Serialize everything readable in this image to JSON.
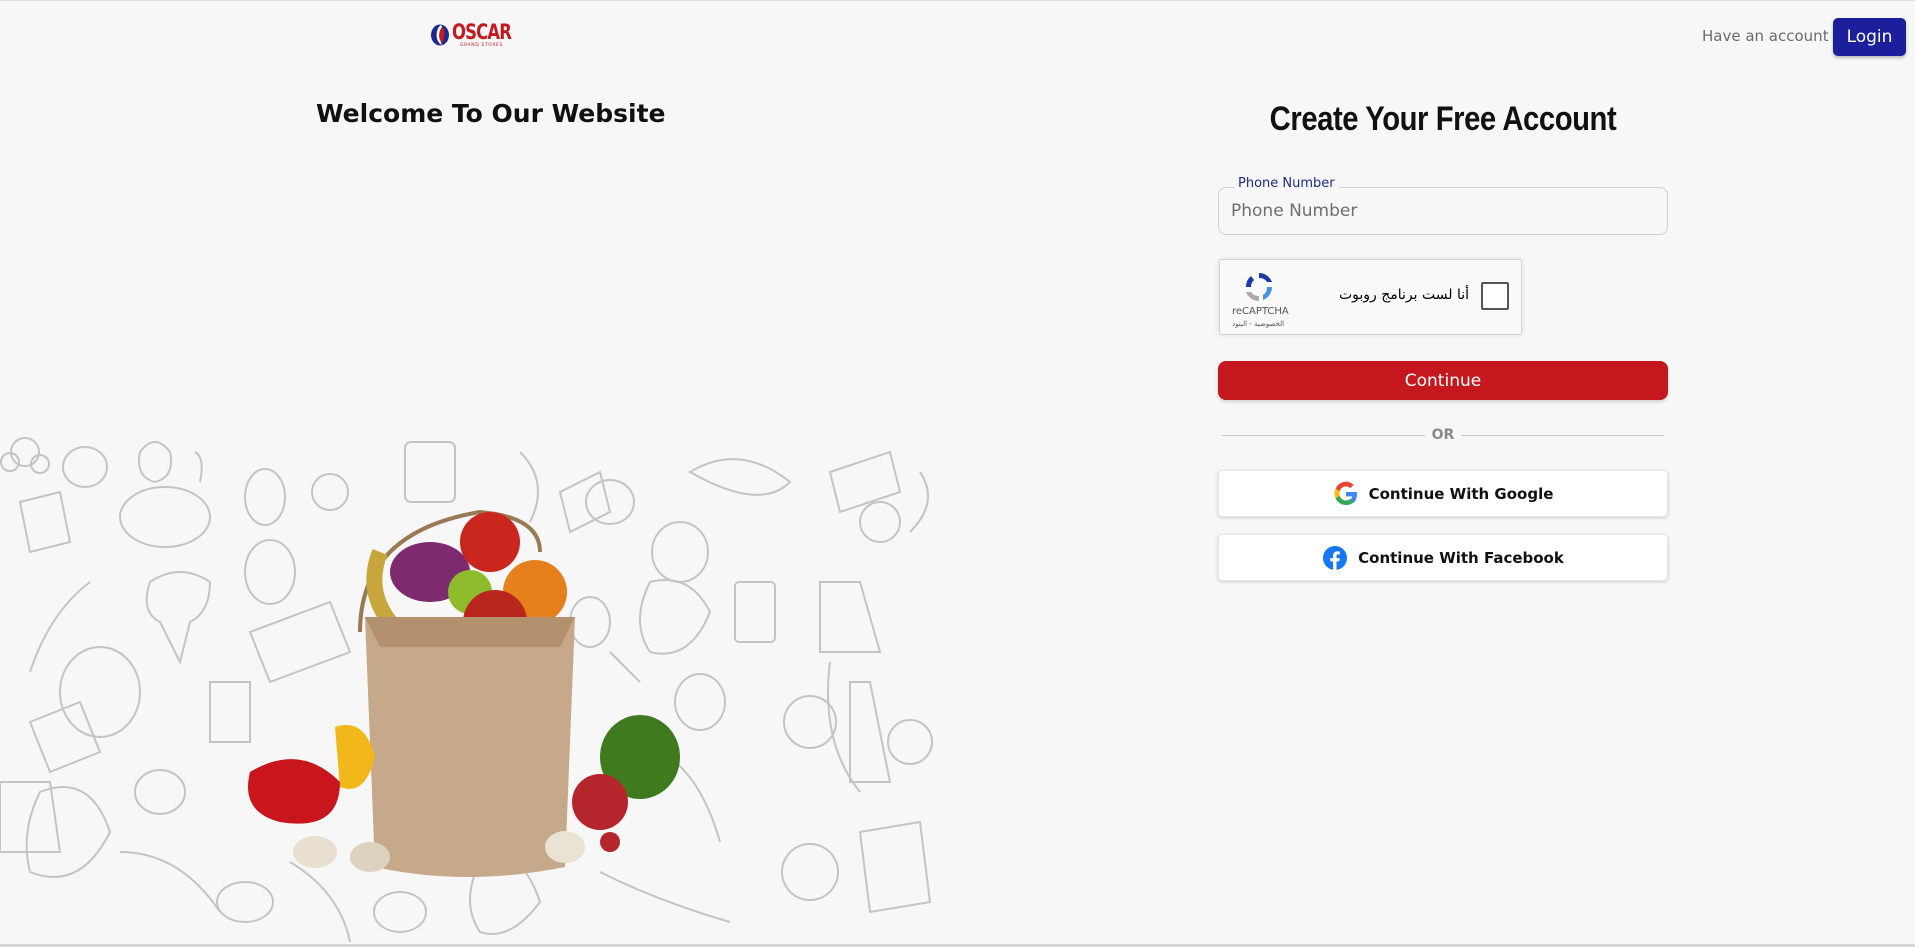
{
  "header": {
    "logo_text": "OSCAR",
    "logo_subtext": "GRAND STORES",
    "have_account_text": "Have an account ?",
    "login_label": "Login"
  },
  "left": {
    "welcome_title": "Welcome To Our Website"
  },
  "form": {
    "title": "Create Your Free Account",
    "phone_label": "Phone Number",
    "phone_placeholder": "Phone Number",
    "phone_value": "",
    "recaptcha": {
      "label": "أنا لست برنامج روبوت",
      "brand": "reCAPTCHA",
      "terms": "الخصوصية - البنود"
    },
    "continue_label": "Continue",
    "or_text": "OR",
    "google_label": "Continue With Google",
    "facebook_label": "Continue With Facebook"
  },
  "colors": {
    "brand_red": "#c5181e",
    "brand_blue": "#1b1f9b",
    "background": "#f7f7f7"
  },
  "icons": [
    "oscar-logo-icon",
    "recaptcha-icon",
    "google-icon",
    "facebook-icon"
  ]
}
